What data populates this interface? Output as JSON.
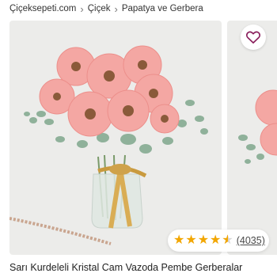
{
  "breadcrumb": {
    "items": [
      "Çiçeksepeti.com",
      "Çiçek",
      "Papatya ve Gerbera"
    ],
    "separator": "›"
  },
  "gallery": {
    "main_image": "pink gerbera bouquet in glass vase with gold ribbon",
    "next_image": "pink gerbera bouquet partial view",
    "favorite_icon": "heart-outline-icon"
  },
  "rating": {
    "stars": 4.5,
    "max_stars": 5,
    "review_count": "(4035)"
  },
  "product": {
    "title": "Sarı Kurdeleli Kristal Cam Vazoda Pembe Gerberalar"
  },
  "colors": {
    "accent": "#8a1f5c",
    "star": "#f2a600",
    "image_bg": "#ececea",
    "flower": "#f4a7a3"
  }
}
